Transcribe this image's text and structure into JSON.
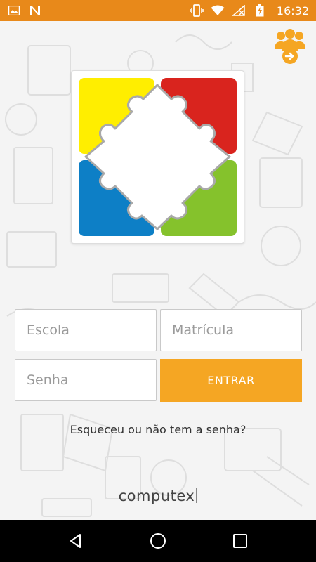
{
  "status_bar": {
    "time": "16:32",
    "icons": [
      "image-icon",
      "n-app-icon",
      "vibrate-icon",
      "wifi-icon",
      "no-signal-icon",
      "battery-charging-icon"
    ]
  },
  "header": {
    "group_icon": "group-users-login-icon"
  },
  "form": {
    "escola_placeholder": "Escola",
    "matricula_placeholder": "Matrícula",
    "senha_placeholder": "Senha",
    "submit_label": "ENTRAR"
  },
  "forgot_link": "Esqueceu ou não tem a senha?",
  "brand": "computex",
  "colors": {
    "status_bar": "#e8891a",
    "accent": "#f5a623",
    "puzzle_yellow": "#ffee00",
    "puzzle_red": "#d9241e",
    "puzzle_blue": "#0d7fc6",
    "puzzle_green": "#85c22c"
  },
  "nav": [
    "back-icon",
    "home-icon",
    "recents-icon"
  ]
}
